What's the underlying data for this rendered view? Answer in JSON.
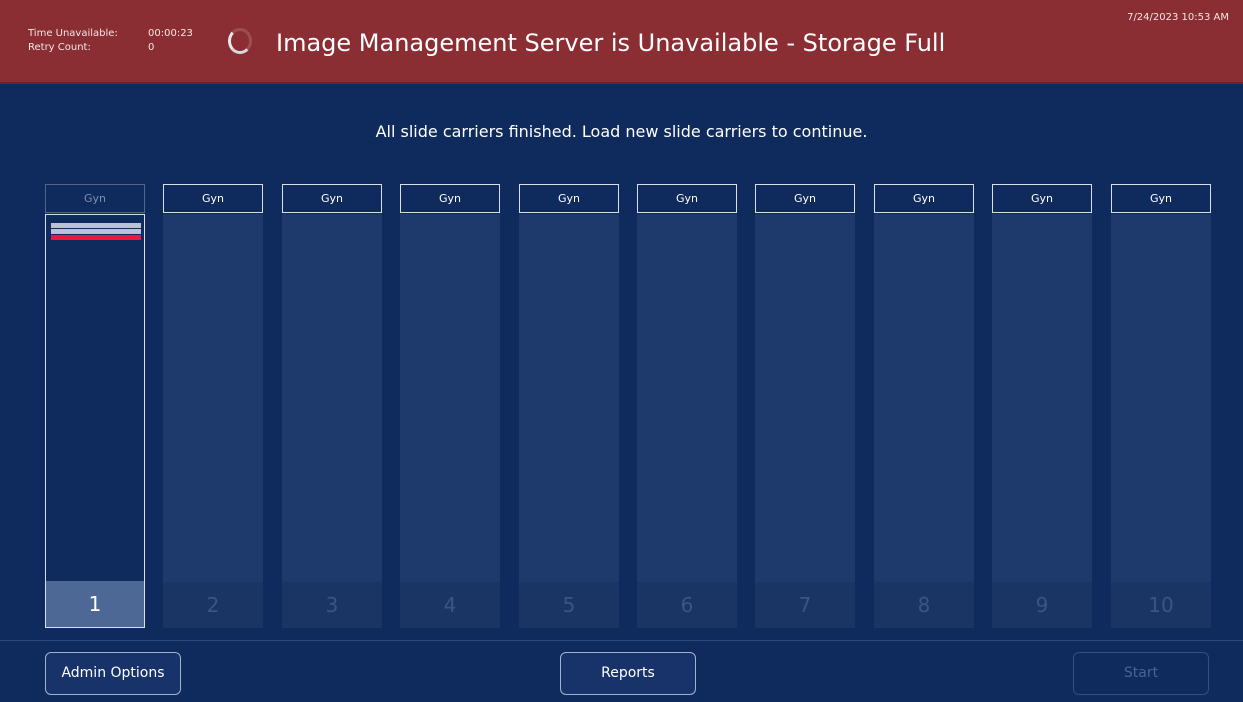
{
  "status": {
    "time_unavailable_label": "Time Unavailable:",
    "time_unavailable_value": "00:00:23",
    "retry_count_label": "Retry Count:",
    "retry_count_value": "0",
    "title": "Image Management Server is Unavailable - Storage Full",
    "datetime": "7/24/2023 10:53 AM",
    "background_color": "#8a2e33"
  },
  "message": "All slide carriers finished. Load new slide carriers to continue.",
  "carriers": [
    {
      "type": "Gyn",
      "number": "1",
      "active": true,
      "slides": [
        "processed",
        "processed",
        "error"
      ]
    },
    {
      "type": "Gyn",
      "number": "2",
      "active": false,
      "slides": []
    },
    {
      "type": "Gyn",
      "number": "3",
      "active": false,
      "slides": []
    },
    {
      "type": "Gyn",
      "number": "4",
      "active": false,
      "slides": []
    },
    {
      "type": "Gyn",
      "number": "5",
      "active": false,
      "slides": []
    },
    {
      "type": "Gyn",
      "number": "6",
      "active": false,
      "slides": []
    },
    {
      "type": "Gyn",
      "number": "7",
      "active": false,
      "slides": []
    },
    {
      "type": "Gyn",
      "number": "8",
      "active": false,
      "slides": []
    },
    {
      "type": "Gyn",
      "number": "9",
      "active": false,
      "slides": []
    },
    {
      "type": "Gyn",
      "number": "10",
      "active": false,
      "slides": []
    }
  ],
  "slide_colors": {
    "processed": "#b9c2d3",
    "error": "#e8193a"
  },
  "footer": {
    "admin_label": "Admin Options",
    "reports_label": "Reports",
    "start_label": "Start",
    "start_enabled": false
  }
}
